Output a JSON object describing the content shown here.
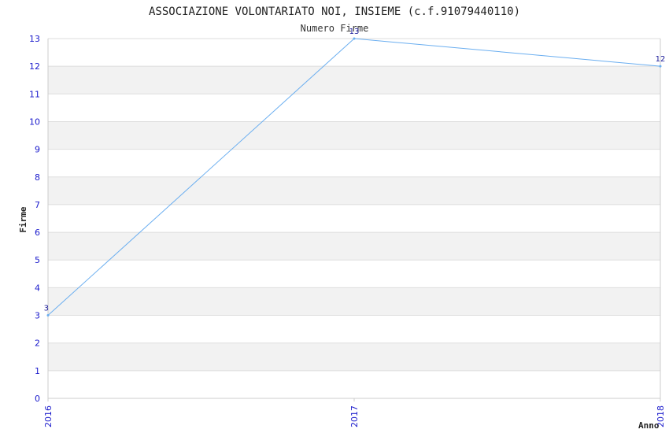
{
  "chart_data": {
    "type": "line",
    "title": "ASSOCIAZIONE VOLONTARIATO NOI, INSIEME (c.f.91079440110)",
    "subtitle": "Numero Firme",
    "xlabel": "Anno",
    "ylabel": "Firme",
    "categories": [
      "2016",
      "2017",
      "2018"
    ],
    "series": [
      {
        "values": [
          3,
          13,
          12
        ]
      }
    ],
    "data_labels": [
      "3",
      "13",
      "12"
    ],
    "ylim": [
      0,
      13
    ],
    "yticks": [
      "0",
      "1",
      "2",
      "3",
      "4",
      "5",
      "6",
      "7",
      "8",
      "9",
      "10",
      "11",
      "12",
      "13"
    ],
    "grid": true,
    "colors": {
      "line": "#6aaef0",
      "band": "#f2f2f2",
      "tick_text": "#1a1acc",
      "grid": "#dddddd"
    }
  }
}
